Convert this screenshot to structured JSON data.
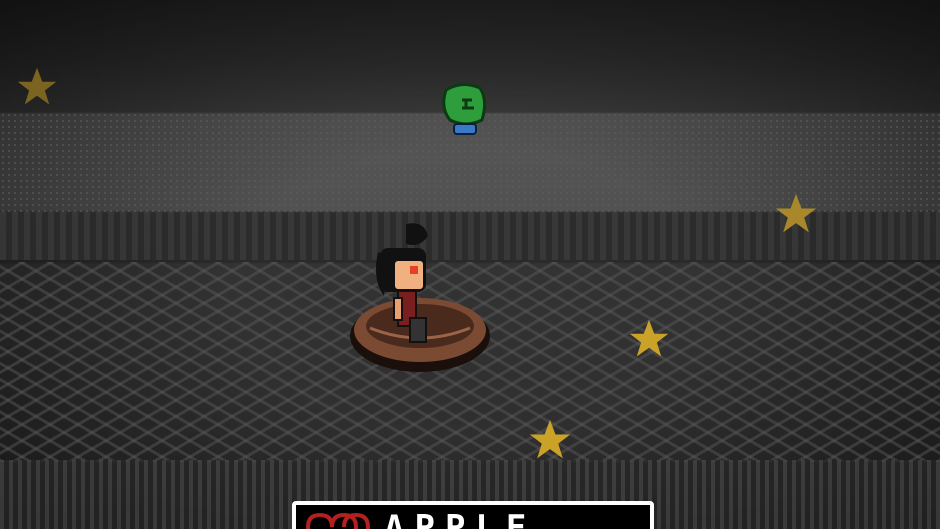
{
  "scene": {
    "speaker_name": "APPLE",
    "colors": {
      "star": "#c9a227",
      "boat": "#7a4a33",
      "frog": "#2e9e3c",
      "dialog_border": "#ffffff",
      "heart": "#b32020"
    }
  },
  "icons": [
    "star-icon",
    "frog-icon",
    "heart-icon"
  ]
}
